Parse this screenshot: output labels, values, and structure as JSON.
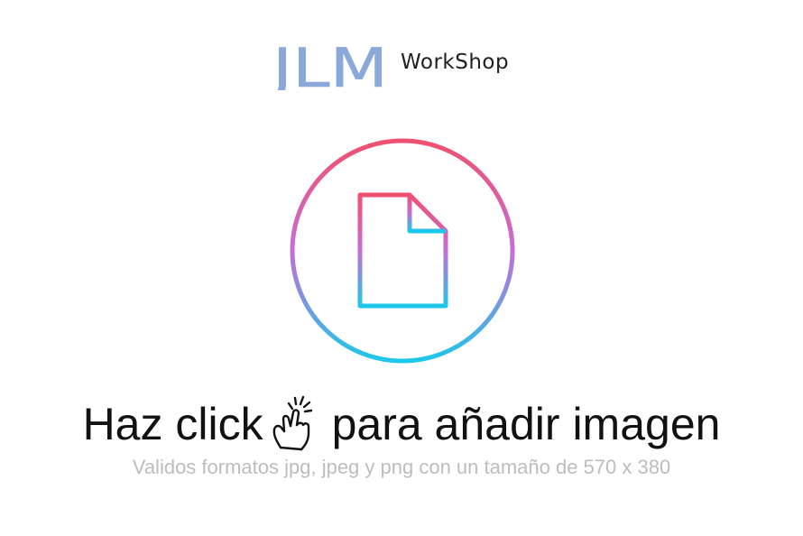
{
  "logo": {
    "mark": "JLM",
    "word": "WorkShop",
    "mark_color": "#8aa8d8"
  },
  "upload": {
    "icon": "file-add-icon",
    "gradient_top": "#f0506e",
    "gradient_middle": "#c86dd7",
    "gradient_bottom": "#1cc8ea"
  },
  "headline": {
    "before": "Haz click",
    "hand_icon": "tap-hand-icon",
    "after": "para añadir imagen"
  },
  "subtext": "Validos formatos jpg, jpeg y png con un tamaño de 570 x 380"
}
